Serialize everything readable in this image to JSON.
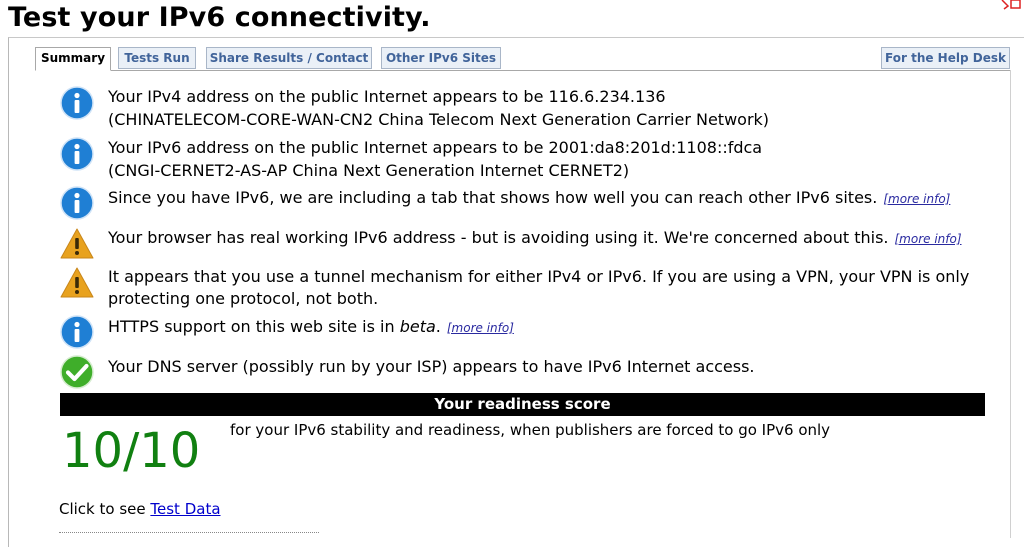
{
  "page": {
    "title": "Test your IPv6 connectivity."
  },
  "tabs": [
    {
      "label": "Summary",
      "active": true
    },
    {
      "label": "Tests Run",
      "active": false
    },
    {
      "label": "Share Results / Contact",
      "active": false
    },
    {
      "label": "Other IPv6 Sites",
      "active": false
    },
    {
      "label": "For the Help Desk",
      "active": false
    }
  ],
  "messages": [
    {
      "icon": "info-icon",
      "line1": "Your IPv4 address on the public Internet appears to be 116.6.234.136",
      "line2": "(CHINATELECOM-CORE-WAN-CN2 China Telecom Next Generation Carrier Network)"
    },
    {
      "icon": "info-icon",
      "line1": "Your IPv6 address on the public Internet appears to be 2001:da8:201d:1108::fdca",
      "line2": "(CNGI-CERNET2-AS-AP China Next Generation Internet CERNET2)"
    },
    {
      "icon": "info-icon",
      "line1": "Since you have IPv6, we are including a tab that shows how well you can reach other IPv6 sites.",
      "more": "[more info]"
    },
    {
      "icon": "warning-icon",
      "line1": "Your browser has real working IPv6 address - but is avoiding using it. We're concerned about this.",
      "more": "[more info]"
    },
    {
      "icon": "warning-icon",
      "line1": "It appears that you use a tunnel mechanism for either IPv4 or IPv6. If you are using a VPN, your VPN is only",
      "line2": "protecting one protocol, not both."
    },
    {
      "icon": "info-icon",
      "line1_prefix": "HTTPS support on this web site is in ",
      "line1_em": "beta",
      "line1_suffix": ".",
      "more": "[more info]"
    },
    {
      "icon": "check-icon",
      "line1": "Your DNS server (possibly run by your ISP) appears to have IPv6 Internet access."
    }
  ],
  "readiness": {
    "heading": "Your readiness score",
    "score": "10/10",
    "description": "for your IPv6 stability and readiness, when publishers are forced to go IPv6 only"
  },
  "test_data": {
    "prefix": "Click to see ",
    "link": "Test Data"
  },
  "colors": {
    "info": "#1f7fd4",
    "warning": "#e8a21f",
    "check": "#3fae2a",
    "score": "#118011",
    "tab_text": "#41649a"
  }
}
